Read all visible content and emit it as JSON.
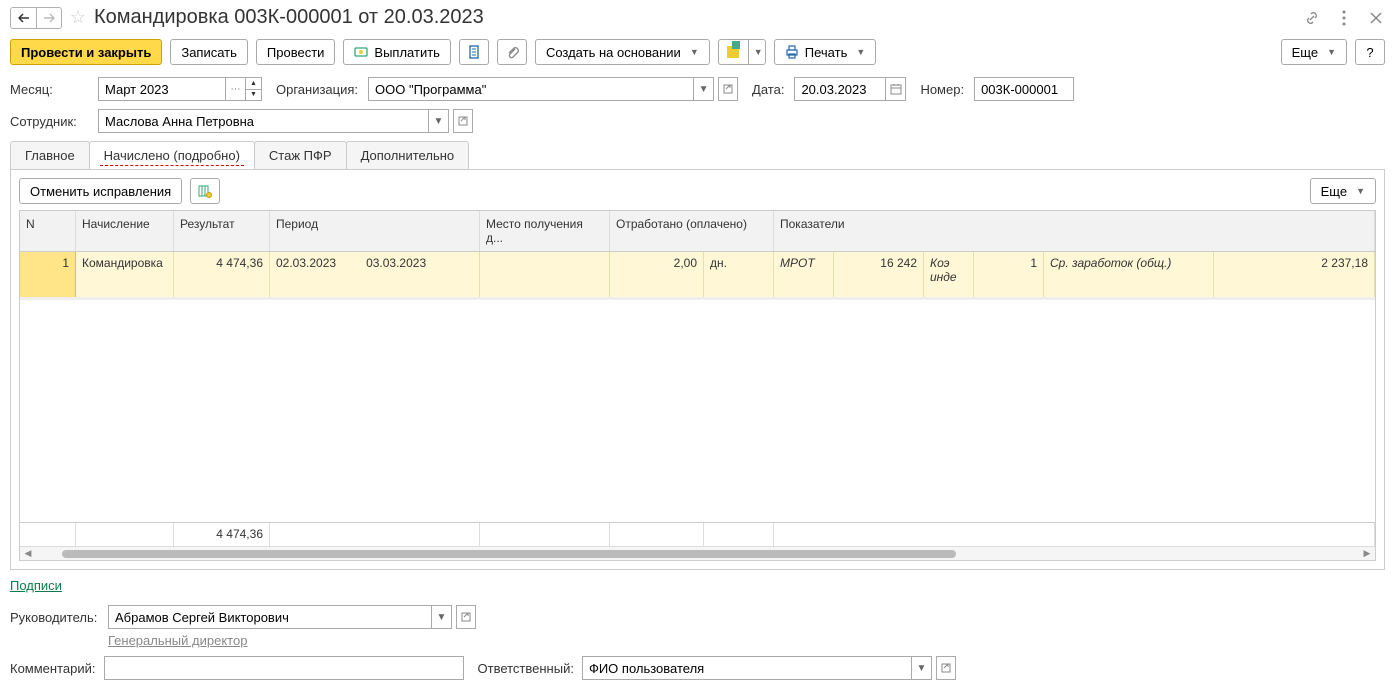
{
  "header": {
    "title": "Командировка 003К-000001 от 20.03.2023"
  },
  "toolbar": {
    "post_close": "Провести и закрыть",
    "save": "Записать",
    "post": "Провести",
    "pay": "Выплатить",
    "create_based": "Создать на основании",
    "print": "Печать",
    "more": "Еще",
    "help": "?"
  },
  "form": {
    "month_label": "Месяц:",
    "month_value": "Март 2023",
    "org_label": "Организация:",
    "org_value": "ООО \"Программа\"",
    "date_label": "Дата:",
    "date_value": "20.03.2023",
    "number_label": "Номер:",
    "number_value": "003К-000001",
    "employee_label": "Сотрудник:",
    "employee_value": "Маслова Анна Петровна"
  },
  "tabs": {
    "main": "Главное",
    "accrued": "Начислено (подробно)",
    "pfr": "Стаж ПФР",
    "extra": "Дополнительно"
  },
  "subtoolbar": {
    "cancel_fix": "Отменить исправления",
    "more": "Еще"
  },
  "table": {
    "headers": {
      "n": "N",
      "accrual": "Начисление",
      "result": "Результат",
      "period": "Период",
      "place": "Место получения д...",
      "worked": "Отработано (оплачено)",
      "indicators": "Показатели"
    },
    "rows": [
      {
        "n": "1",
        "accrual": "Командировка",
        "result": "4 474,36",
        "period_from": "02.03.2023",
        "period_to": "03.03.2023",
        "place": "",
        "worked_qty": "2,00",
        "worked_unit": "дн.",
        "ind1_name": "МРОТ",
        "ind1_val": "16 242",
        "ind2_name": "Коэ инде",
        "ind2_val": "1",
        "ind3_name": "Ср. заработок (общ.)",
        "ind3_val": "2 237,18"
      }
    ],
    "footer": {
      "result_total": "4 474,36"
    }
  },
  "signatures": {
    "link": "Подписи",
    "manager_label": "Руководитель:",
    "manager_value": "Абрамов Сергей Викторович",
    "manager_position": "Генеральный директор"
  },
  "footer": {
    "comment_label": "Комментарий:",
    "comment_value": "",
    "responsible_label": "Ответственный:",
    "responsible_value": "ФИО пользователя"
  }
}
